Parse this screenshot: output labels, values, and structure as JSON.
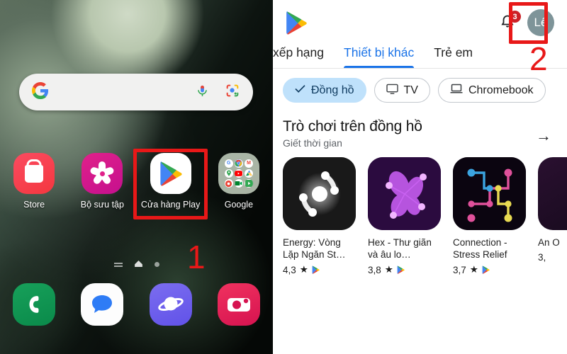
{
  "annotations": {
    "step1": "1",
    "step2": "2"
  },
  "home_screen": {
    "search": {
      "name": "google-search-bar",
      "value": "",
      "placeholder": "",
      "icons": [
        "google-g-icon",
        "microphone-icon",
        "google-lens-icon"
      ]
    },
    "apps": [
      {
        "label": "Store",
        "icon": "galaxy-store-icon"
      },
      {
        "label": "Bộ sưu tập",
        "icon": "gallery-icon"
      },
      {
        "label": "Cửa hàng Play",
        "icon": "google-play-store-icon"
      },
      {
        "label": "Google",
        "icon": "google-folder-icon"
      }
    ],
    "folder_apps": [
      "Google",
      "Chrome",
      "Gmail",
      "Maps",
      "YouTube",
      "Drive",
      "Photos",
      "Meet",
      "YT Music"
    ],
    "page_indicators": [
      "list-icon",
      "home-icon",
      "dot-icon"
    ],
    "dock": [
      {
        "label": "Phone",
        "icon": "phone-icon"
      },
      {
        "label": "Messages",
        "icon": "messages-icon"
      },
      {
        "label": "Internet",
        "icon": "samsung-internet-icon"
      },
      {
        "label": "Camera",
        "icon": "camera-icon"
      }
    ]
  },
  "play_store": {
    "logo": "google-play-logo",
    "notifications": {
      "icon": "bell-icon",
      "count": "3"
    },
    "account": {
      "name": "avatar",
      "initial": "Lê"
    },
    "tabs": [
      {
        "label": "xếp hạng",
        "active": false
      },
      {
        "label": "Thiết bị khác",
        "active": true
      },
      {
        "label": "Trẻ em",
        "active": false
      }
    ],
    "chips": [
      {
        "label": "Đồng hồ",
        "icon": "check-icon",
        "selected": true
      },
      {
        "label": "TV",
        "icon": "tv-icon",
        "selected": false
      },
      {
        "label": "Chromebook",
        "icon": "laptop-icon",
        "selected": false
      }
    ],
    "section": {
      "title": "Trò chơi trên đồng hồ",
      "subtitle": "Giết thời gian",
      "more_icon": "arrow-right-icon"
    },
    "apps": [
      {
        "name": "Energy: Vòng Lặp Ngăn St…",
        "rating": "4,3",
        "star": "★",
        "badge": "google-play-badge"
      },
      {
        "name": "Hex -  Thư giãn và âu lo…",
        "rating": "3,8",
        "star": "★",
        "badge": "google-play-badge"
      },
      {
        "name": "Connection - Stress Relief",
        "rating": "3,7",
        "star": "★",
        "badge": "google-play-badge"
      },
      {
        "name": "An O",
        "rating": "3,",
        "star": "",
        "badge": "google-play-badge"
      }
    ]
  },
  "colors": {
    "annotation_red": "#e81818",
    "play_blue": "#1a73e8",
    "chip_selected": "#bfe1fb",
    "badge_red": "#cc2127",
    "avatar_bg": "#7e9499"
  }
}
